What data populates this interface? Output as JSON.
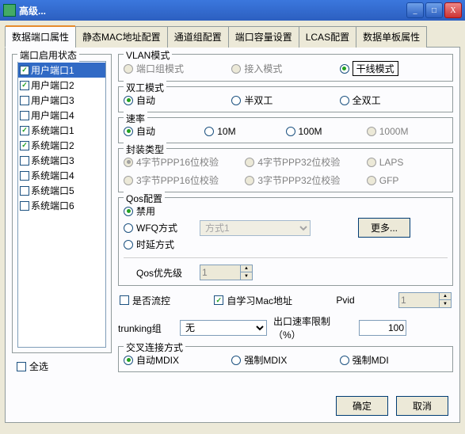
{
  "window": {
    "title": "高级..."
  },
  "tabs": [
    "数据端口属性",
    "静态MAC地址配置",
    "通道组配置",
    "端口容量设置",
    "LCAS配置",
    "数据单板属性"
  ],
  "activeTab": 0,
  "portgroup": {
    "legend": "端口启用状态",
    "items": [
      {
        "label": "用户端口1",
        "checked": true,
        "selected": true
      },
      {
        "label": "用户端口2",
        "checked": true,
        "selected": false
      },
      {
        "label": "用户端口3",
        "checked": false,
        "selected": false
      },
      {
        "label": "用户端口4",
        "checked": false,
        "selected": false
      },
      {
        "label": "系统端口1",
        "checked": true,
        "selected": false
      },
      {
        "label": "系统端口2",
        "checked": true,
        "selected": false
      },
      {
        "label": "系统端口3",
        "checked": false,
        "selected": false
      },
      {
        "label": "系统端口4",
        "checked": false,
        "selected": false
      },
      {
        "label": "系统端口5",
        "checked": false,
        "selected": false
      },
      {
        "label": "系统端口6",
        "checked": false,
        "selected": false
      }
    ],
    "selectall": "全选"
  },
  "vlan": {
    "legend": "VLAN模式",
    "opts": [
      "端口组模式",
      "接入模式",
      "干线模式"
    ]
  },
  "duplex": {
    "legend": "双工模式",
    "opts": [
      "自动",
      "半双工",
      "全双工"
    ]
  },
  "rate": {
    "legend": "速率",
    "opts": [
      "自动",
      "10M",
      "100M",
      "1000M"
    ]
  },
  "encaps": {
    "legend": "封装类型",
    "opts": [
      "4字节PPP16位校验",
      "4字节PPP32位校验",
      "LAPS",
      "3字节PPP16位校验",
      "3字节PPP32位校验",
      "GFP"
    ]
  },
  "qos": {
    "legend": "Qos配置",
    "opts": [
      "禁用",
      "WFQ方式",
      "时延方式"
    ],
    "method": "方式1",
    "more": "更多...",
    "priolabel": "Qos优先级",
    "prioval": "1"
  },
  "flow": {
    "flowctl": "是否流控",
    "automac": "自学习Mac地址",
    "pvid": "Pvid",
    "pvidval": "1"
  },
  "trunk": {
    "label": "trunking组",
    "value": "无",
    "ratelabel": "出口速率限制（%）",
    "rateval": "100"
  },
  "conn": {
    "legend": "交叉连接方式",
    "opts": [
      "自动MDIX",
      "强制MDIX",
      "强制MDI"
    ]
  },
  "buttons": {
    "ok": "确定",
    "cancel": "取消"
  }
}
